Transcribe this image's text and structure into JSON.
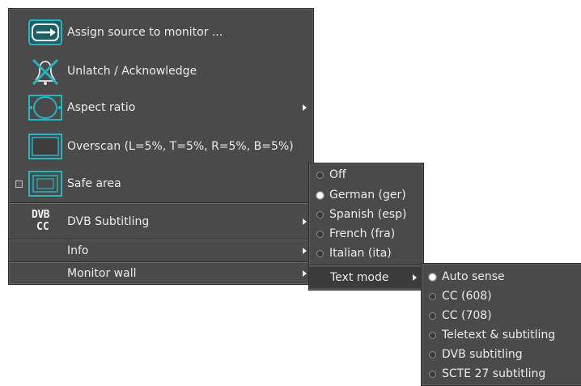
{
  "main_menu": {
    "items": [
      {
        "label": "Assign source to monitor ...",
        "icon": "assign-source-icon"
      },
      {
        "label": "Unlatch / Acknowledge",
        "icon": "unlatch-bell-icon"
      },
      {
        "label": "Aspect ratio",
        "icon": "aspect-ratio-icon",
        "has_submenu": true
      },
      {
        "label": "Overscan (L=5%, T=5%, R=5%, B=5%)",
        "icon": "overscan-icon"
      },
      {
        "label": "Safe area",
        "icon": "safe-area-icon",
        "checked": false
      },
      {
        "label": "DVB Subtitling",
        "icon": "dvb-cc-icon",
        "has_submenu": true,
        "icon_text_top": "DVB",
        "icon_text_bottom": "CC"
      },
      {
        "label": "Info",
        "has_submenu": true
      },
      {
        "label": "Monitor wall",
        "has_submenu": true
      }
    ]
  },
  "dvb_submenu": {
    "items": [
      {
        "label": "Off",
        "selected": false
      },
      {
        "label": "German (ger)",
        "selected": true
      },
      {
        "label": "Spanish (esp)",
        "selected": false
      },
      {
        "label": "French (fra)",
        "selected": false
      },
      {
        "label": "Italian (ita)",
        "selected": false
      }
    ],
    "text_mode_label": "Text mode"
  },
  "text_mode_submenu": {
    "items": [
      {
        "label": "Auto sense",
        "selected": true
      },
      {
        "label": "CC (608)",
        "selected": false
      },
      {
        "label": "CC (708)",
        "selected": false
      },
      {
        "label": "Teletext & subtitling",
        "selected": false
      },
      {
        "label": "DVB subtitling",
        "selected": false
      },
      {
        "label": "SCTE 27 subtitling",
        "selected": false
      }
    ]
  },
  "colors": {
    "menu_bg": "#4a4a4a",
    "icon_teal": "#2bb3c0",
    "text": "#ececec"
  }
}
